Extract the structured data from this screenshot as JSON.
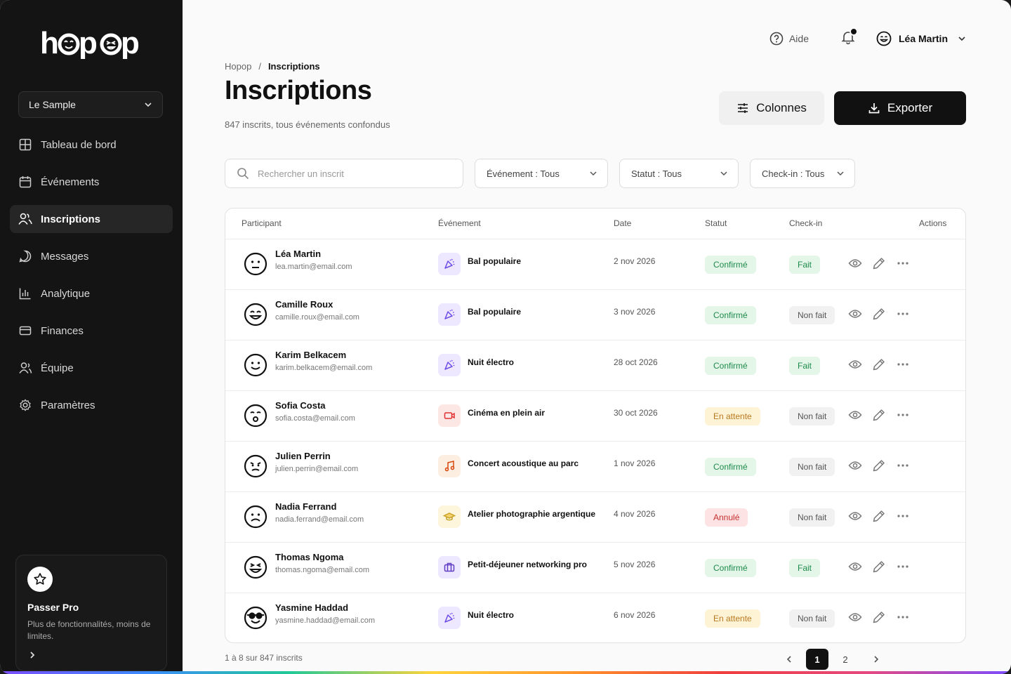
{
  "brand": {
    "logo_text": "hopop"
  },
  "org": {
    "selected": "Le Sample"
  },
  "nav": [
    {
      "label": "Tableau de bord",
      "icon": "grid-icon"
    },
    {
      "label": "Événements",
      "icon": "calendar-icon"
    },
    {
      "label": "Inscriptions",
      "icon": "users-icon",
      "active": true
    },
    {
      "label": "Messages",
      "icon": "chat-icon"
    },
    {
      "label": "Analytique",
      "icon": "bar-chart-icon"
    },
    {
      "label": "Finances",
      "icon": "card-icon"
    },
    {
      "label": "Équipe",
      "icon": "team-icon"
    },
    {
      "label": "Paramètres",
      "icon": "gear-icon"
    }
  ],
  "promo": {
    "title": "Passer Pro",
    "text": "Plus de fonctionnalités, moins de limites."
  },
  "topbar": {
    "help": "Aide",
    "user": "Léa Martin"
  },
  "breadcrumb": {
    "root": "Hopop",
    "sep": "/",
    "current": "Inscriptions"
  },
  "header": {
    "title": "Inscriptions",
    "subtitle": "847 inscrits, tous événements confondus",
    "columns_label": "Colonnes",
    "export_label": "Exporter"
  },
  "filters": {
    "search_placeholder": "Rechercher un inscrit",
    "event": "Événement : Tous",
    "status": "Statut : Tous",
    "checkin": "Check-in : Tous"
  },
  "table": {
    "columns": {
      "participant": "Participant",
      "event": "Événement",
      "date": "Date",
      "status": "Statut",
      "checkin": "Check-in",
      "actions": "Actions"
    },
    "rows": [
      {
        "name": "Léa Martin",
        "email": "lea.martin@email.com",
        "face": "neutral",
        "event": "Bal populaire",
        "event_icon": "party-icon",
        "date": "2 nov 2026",
        "status": "Confirmé",
        "status_kind": "ok",
        "checkin": "Fait",
        "checkin_kind": "done"
      },
      {
        "name": "Camille Roux",
        "email": "camille.roux@email.com",
        "face": "happy",
        "event": "Bal populaire",
        "event_icon": "party-icon",
        "date": "3 nov 2026",
        "status": "Confirmé",
        "status_kind": "ok",
        "checkin": "Non fait",
        "checkin_kind": "no"
      },
      {
        "name": "Karim Belkacem",
        "email": "karim.belkacem@email.com",
        "face": "smile",
        "event": "Nuit électro",
        "event_icon": "party-icon",
        "date": "28 oct 2026",
        "status": "Confirmé",
        "status_kind": "ok",
        "checkin": "Fait",
        "checkin_kind": "done"
      },
      {
        "name": "Sofia Costa",
        "email": "sofia.costa@email.com",
        "face": "surprised",
        "event": "Cinéma en plein air",
        "event_icon": "camera-icon",
        "date": "30 oct 2026",
        "status": "En attente",
        "status_kind": "wait",
        "checkin": "Non fait",
        "checkin_kind": "no"
      },
      {
        "name": "Julien Perrin",
        "email": "julien.perrin@email.com",
        "face": "mad",
        "event": "Concert acoustique au parc",
        "event_icon": "music-icon",
        "date": "1 nov 2026",
        "status": "Confirmé",
        "status_kind": "ok",
        "checkin": "Non fait",
        "checkin_kind": "no"
      },
      {
        "name": "Nadia Ferrand",
        "email": "nadia.ferrand@email.com",
        "face": "sad",
        "event": "Atelier photographie argentique",
        "event_icon": "graduation-icon",
        "date": "4 nov 2026",
        "status": "Annulé",
        "status_kind": "cancel",
        "checkin": "Non fait",
        "checkin_kind": "no"
      },
      {
        "name": "Thomas Ngoma",
        "email": "thomas.ngoma@email.com",
        "face": "squint",
        "event": "Petit-déjeuner networking pro",
        "event_icon": "briefcase-icon",
        "date": "5 nov 2026",
        "status": "Confirmé",
        "status_kind": "ok",
        "checkin": "Fait",
        "checkin_kind": "done"
      },
      {
        "name": "Yasmine Haddad",
        "email": "yasmine.haddad@email.com",
        "face": "glasses",
        "event": "Nuit électro",
        "event_icon": "party-icon",
        "date": "6 nov 2026",
        "status": "En attente",
        "status_kind": "wait",
        "checkin": "Non fait",
        "checkin_kind": "no"
      }
    ]
  },
  "footer": {
    "count": "1 à 8 sur 847 inscrits",
    "pages": [
      "1",
      "2"
    ],
    "current_page": "1"
  },
  "colors": {
    "accent": "#111111",
    "sidebar_bg": "#141414",
    "ok": "#1f8a4c",
    "wait": "#b7791f",
    "cancel": "#c53030",
    "event_purple": "#ede8ff",
    "event_red": "#fde7e5",
    "event_orange": "#fdeee2",
    "event_yellow": "#fdf5dc"
  }
}
